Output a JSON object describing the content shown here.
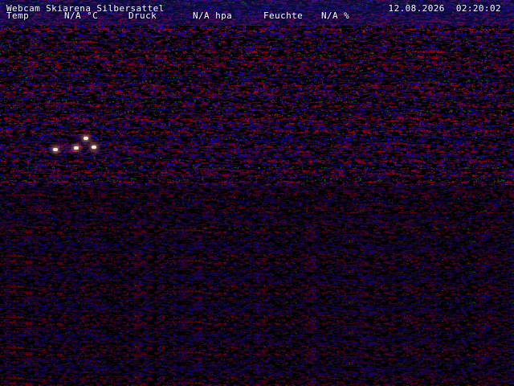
{
  "overlay": {
    "title": "Webcam Skiarena Silbersattel",
    "datetime": "12.08.2026  02:20:02",
    "temp_label": "Temp",
    "temp_value": "N/A °C",
    "pressure_label": "Druck",
    "pressure_value": "N/A hpa",
    "humidity_label": "Feuchte",
    "humidity_value": "N/A %"
  },
  "image": {
    "description_icon": "webcam-noise-image",
    "colors": {
      "noise_red": "#ff2a3a",
      "noise_blue": "#3a2aff",
      "noise_magenta": "#c03aff",
      "noise_green": "#2aff5a",
      "background": "#000000"
    }
  }
}
